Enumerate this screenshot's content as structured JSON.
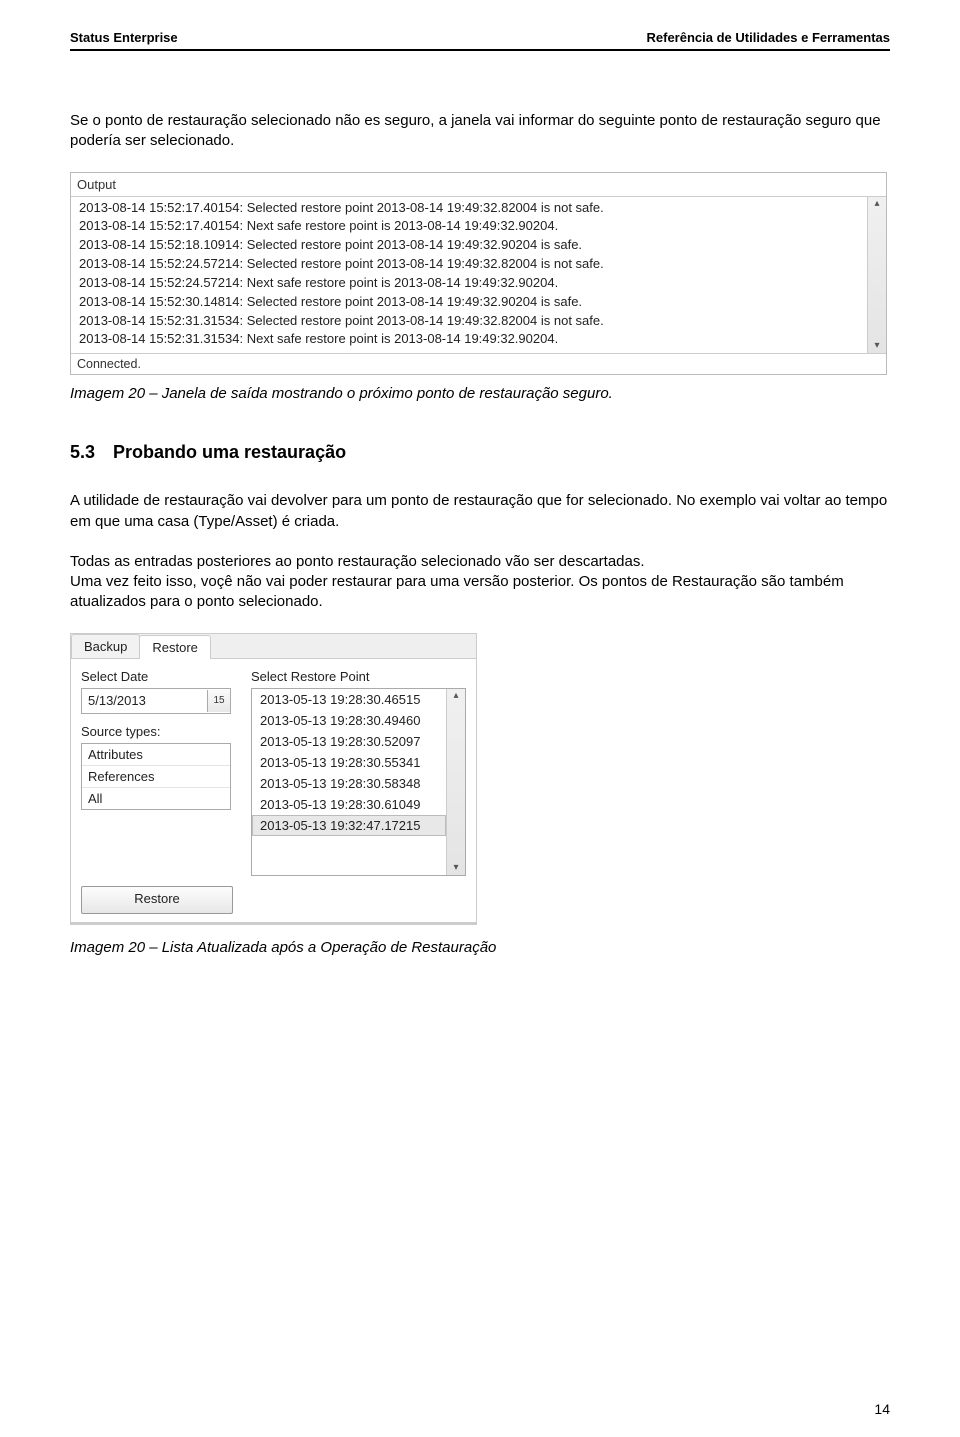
{
  "header": {
    "left": "Status Enterprise",
    "right": "Referência de Utilidades e Ferramentas"
  },
  "para1": "Se o ponto de restauração selecionado não es seguro, a janela vai informar do seguinte ponto de restauração seguro que podería ser selecionado.",
  "output_panel": {
    "title": "Output",
    "lines": [
      "2013-08-14 15:52:17.40154: Selected restore point 2013-08-14 19:49:32.82004 is not safe.",
      "2013-08-14 15:52:17.40154: Next safe restore point is 2013-08-14 19:49:32.90204.",
      "2013-08-14 15:52:18.10914: Selected restore point 2013-08-14 19:49:32.90204 is safe.",
      "2013-08-14 15:52:24.57214: Selected restore point 2013-08-14 19:49:32.82004 is not safe.",
      "2013-08-14 15:52:24.57214: Next safe restore point is 2013-08-14 19:49:32.90204.",
      "2013-08-14 15:52:30.14814: Selected restore point 2013-08-14 19:49:32.90204 is safe.",
      "2013-08-14 15:52:31.31534: Selected restore point 2013-08-14 19:49:32.82004 is not safe.",
      "2013-08-14 15:52:31.31534: Next safe restore point is 2013-08-14 19:49:32.90204."
    ],
    "status": "Connected."
  },
  "caption1": "Imagem 20 – Janela de saída mostrando o próximo ponto de restauração seguro.",
  "section": {
    "number": "5.3",
    "title": "Probando uma restauração"
  },
  "para2": "A utilidade de restauração vai devolver para um ponto de restauração que for selecionado. No exemplo vai voltar ao tempo em que uma casa (Type/Asset) é criada.",
  "para3_line1": "Todas as entradas posteriores ao ponto restauração selecionado vão ser descartadas.",
  "para3_line2": "Uma vez feito isso, voçê não vai poder restaurar para uma versão posterior. Os pontos de Restauração são também atualizados para o ponto selecionado.",
  "restore_panel": {
    "tabs": {
      "backup": "Backup",
      "restore": "Restore"
    },
    "select_date_label": "Select Date",
    "date_value": "5/13/2013",
    "cal_day": "15",
    "source_types_label": "Source types:",
    "source_options": [
      "Attributes",
      "References",
      "All"
    ],
    "select_restore_label": "Select Restore Point",
    "restore_points": [
      "2013-05-13 19:28:30.46515",
      "2013-05-13 19:28:30.49460",
      "2013-05-13 19:28:30.52097",
      "2013-05-13 19:28:30.55341",
      "2013-05-13 19:28:30.58348",
      "2013-05-13 19:28:30.61049",
      "2013-05-13 19:32:47.17215"
    ],
    "selected_index": 6,
    "restore_button": "Restore"
  },
  "caption2": "Imagem 20 – Lista Atualizada após a Operação de Restauração",
  "page_number": "14"
}
